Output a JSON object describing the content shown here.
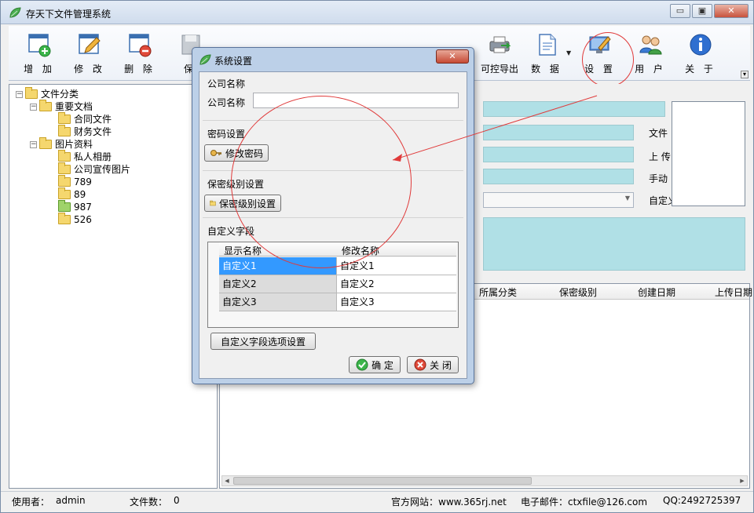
{
  "app": {
    "title": "存天下文件管理系统"
  },
  "window_controls": {
    "minimize": "▭",
    "restore": "▣",
    "close": "✕"
  },
  "toolbar": {
    "items": [
      {
        "label": "增 加",
        "icon": "add-window-icon"
      },
      {
        "label": "修 改",
        "icon": "edit-pencil-icon"
      },
      {
        "label": "删 除",
        "icon": "delete-window-icon"
      },
      {
        "label": "保",
        "icon": "save-icon"
      },
      {
        "label": "可控导出",
        "icon": "export-printer-icon"
      },
      {
        "label": "数 据",
        "icon": "data-document-icon"
      },
      {
        "label": "设 置",
        "icon": "settings-monitor-icon"
      },
      {
        "label": "用 户",
        "icon": "users-icon"
      },
      {
        "label": "关 于",
        "icon": "info-icon"
      }
    ]
  },
  "tree": {
    "nodes": [
      {
        "label": "文件分类"
      },
      {
        "label": "重要文档"
      },
      {
        "label": "合同文件"
      },
      {
        "label": "财务文件"
      },
      {
        "label": "图片资料"
      },
      {
        "label": "私人相册"
      },
      {
        "label": "公司宣传图片"
      },
      {
        "label": "789"
      },
      {
        "label": "89"
      },
      {
        "label": "987"
      },
      {
        "label": "526"
      }
    ]
  },
  "detail": {
    "labels": {
      "file": "文件",
      "upload": "上 传",
      "manual": "手动",
      "custom": "自定义"
    }
  },
  "grid": {
    "columns": [
      "所属分类",
      "保密级别",
      "创建日期",
      "上传日期"
    ]
  },
  "status": {
    "user_label": "使用者：",
    "user_value": "admin",
    "count_label": "文件数：",
    "count_value": "0",
    "website": "官方网站：www.365rj.net",
    "email": "电子邮件：ctxfile@126.com",
    "qq": "QQ:2492725397"
  },
  "dialog": {
    "title": "系统设置",
    "close": "✕",
    "company": {
      "section": "公司名称",
      "label": "公司名称",
      "value": ""
    },
    "password": {
      "section": "密码设置",
      "button": "修改密码"
    },
    "security": {
      "section": "保密级别设置",
      "button": "保密级别设置"
    },
    "custom": {
      "section": "自定义字段",
      "headers": [
        "显示名称",
        "修改名称"
      ],
      "rows": [
        {
          "display": "自定义1",
          "rename": "自定义1"
        },
        {
          "display": "自定义2",
          "rename": "自定义2"
        },
        {
          "display": "自定义3",
          "rename": "自定义3"
        }
      ],
      "options_button": "自定义字段选项设置"
    },
    "ok": "确 定",
    "cancel": "关 闭"
  },
  "colors": {
    "annotation_red": "#e03a3a",
    "selection_blue": "#3399ff",
    "field_cyan": "#b0e0e6"
  }
}
